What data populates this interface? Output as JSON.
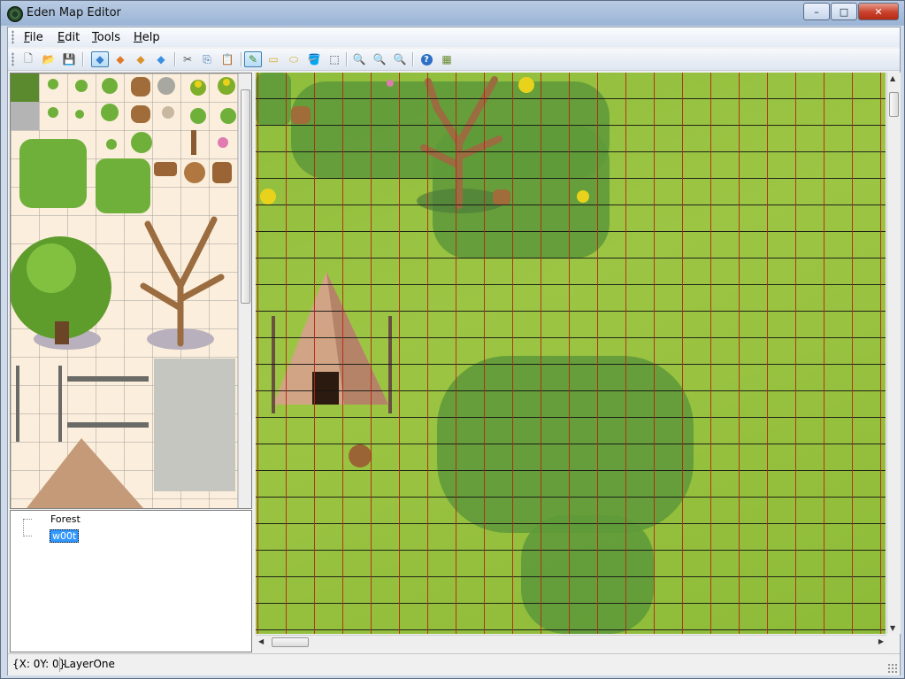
{
  "window": {
    "title": "Eden Map Editor",
    "min": "–",
    "max": "□",
    "close": "✕"
  },
  "menu": {
    "items": [
      "File",
      "Edit",
      "Tools",
      "Help"
    ]
  },
  "toolbar": {
    "buttons": [
      {
        "icon": "new-file-icon",
        "glyph": "🗋"
      },
      {
        "icon": "open-folder-icon",
        "glyph": "📂"
      },
      {
        "icon": "save-icon",
        "glyph": "💾"
      },
      {
        "icon": "layer-one-icon",
        "glyph": "◆"
      },
      {
        "icon": "layer-two-icon",
        "glyph": "◆"
      },
      {
        "icon": "layer-three-icon",
        "glyph": "◆"
      },
      {
        "icon": "layer-four-icon",
        "glyph": "◆"
      },
      {
        "icon": "cut-icon",
        "glyph": "✂"
      },
      {
        "icon": "copy-icon",
        "glyph": "⎘"
      },
      {
        "icon": "paste-icon",
        "glyph": "📋"
      },
      {
        "icon": "pencil-icon",
        "glyph": "✎"
      },
      {
        "icon": "rectangle-icon",
        "glyph": "▭"
      },
      {
        "icon": "ellipse-icon",
        "glyph": "⬭"
      },
      {
        "icon": "fill-icon",
        "glyph": "🪣"
      },
      {
        "icon": "select-icon",
        "glyph": "⬚"
      },
      {
        "icon": "zoom-icon",
        "glyph": "🔍"
      },
      {
        "icon": "zoom-in-icon",
        "glyph": "🔍"
      },
      {
        "icon": "zoom-out-icon",
        "glyph": "🔍"
      },
      {
        "icon": "help-icon",
        "glyph": "?"
      },
      {
        "icon": "tileset-icon",
        "glyph": "▦"
      }
    ]
  },
  "tree": {
    "root": "Forest",
    "child": "w00t"
  },
  "status": {
    "coords": "{X: 0Y: 0}",
    "layer": "LayerOne"
  },
  "colors": {
    "map_grass": "#94c03e",
    "map_dark_grass": "#5f9a3a",
    "grid_vertical": "#b42814",
    "tileset_bg": "#fbeedc"
  }
}
